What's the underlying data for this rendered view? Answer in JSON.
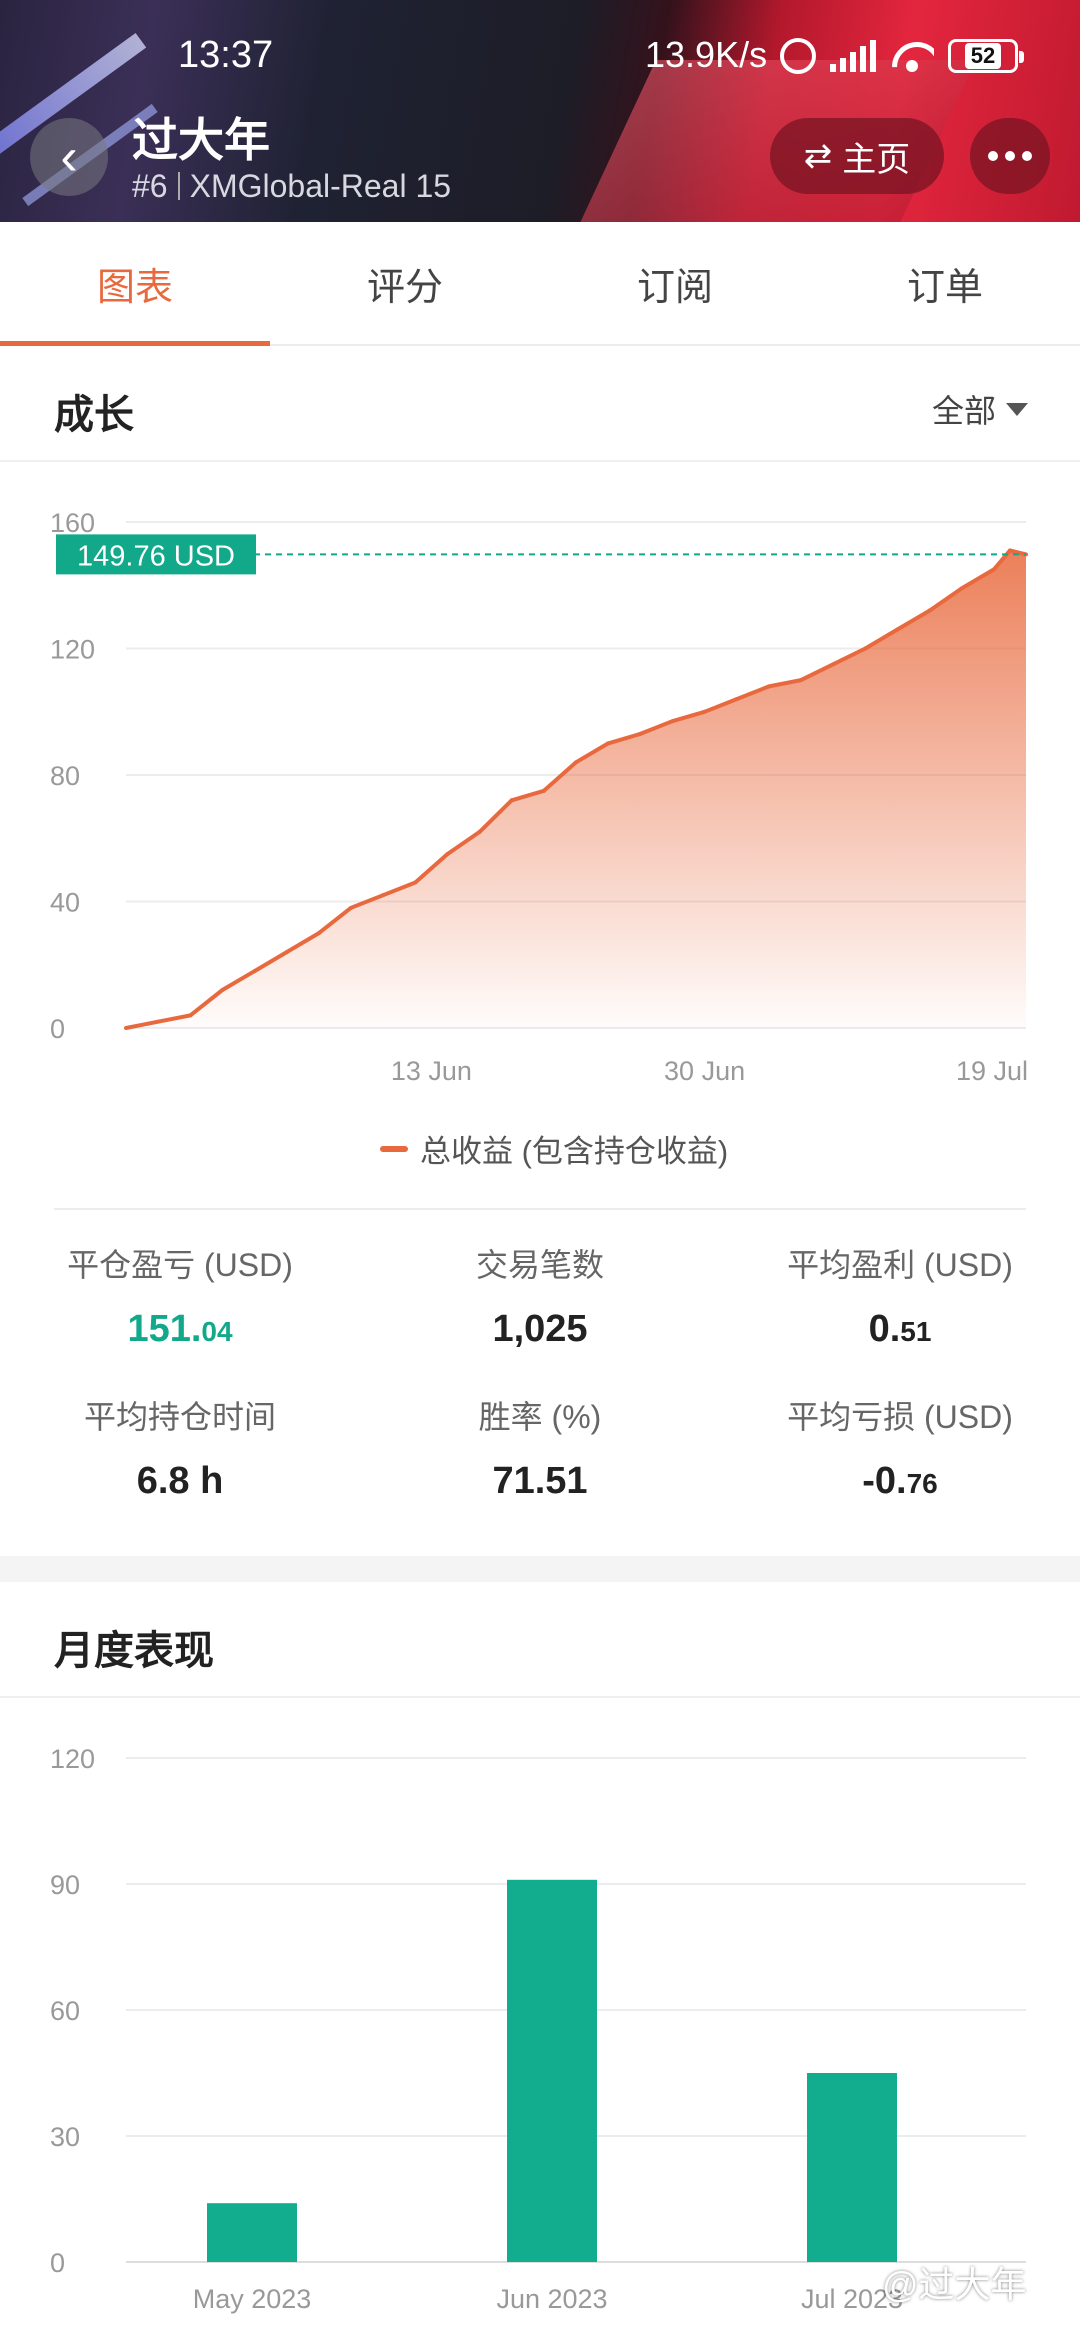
{
  "status_bar": {
    "time": "13:37",
    "net_speed": "13.9K/s",
    "battery": "52",
    "icons": [
      "alarm-icon",
      "signal-icon",
      "wifi-icon",
      "battery-icon"
    ]
  },
  "header": {
    "title": "过大年",
    "rank": "#6",
    "account": "XMGlobal-Real 15",
    "home_label": "主页",
    "icons": [
      "back-arrow-icon",
      "swap-icon",
      "more-icon"
    ]
  },
  "tabs": [
    {
      "label": "图表",
      "active": true
    },
    {
      "label": "评分",
      "active": false
    },
    {
      "label": "订阅",
      "active": false
    },
    {
      "label": "订单",
      "active": false
    }
  ],
  "growth": {
    "title": "成长",
    "filter_label": "全部",
    "current_value_label": "149.76 USD",
    "legend": "总收益 (包含持仓收益)"
  },
  "stats": [
    {
      "label": "平仓盈亏 (USD)",
      "main": "151.",
      "small": "04",
      "color": "green"
    },
    {
      "label": "交易笔数",
      "main": "1,025",
      "small": "",
      "color": "default"
    },
    {
      "label": "平均盈利 (USD)",
      "main": "0.",
      "small": "51",
      "color": "default"
    },
    {
      "label": "平均持仓时间",
      "main": "6.8 h",
      "small": "",
      "color": "default"
    },
    {
      "label": "胜率 (%)",
      "main": "71.51",
      "small": "",
      "color": "default"
    },
    {
      "label": "平均亏损 (USD)",
      "main": "-0.",
      "small": "76",
      "color": "default"
    }
  ],
  "monthly": {
    "title": "月度表现"
  },
  "watermark": "@过大年",
  "colors": {
    "accent": "#e8693d",
    "green": "#12a88a",
    "bar": "#12ad8e"
  },
  "chart_data": [
    {
      "type": "area",
      "title": "",
      "ylim": [
        0,
        160
      ],
      "yticks": [
        0,
        40,
        80,
        120,
        160
      ],
      "xticks": [
        "13 Jun",
        "30 Jun",
        "19 Jul"
      ],
      "reference_line": 149.76,
      "series": [
        {
          "name": "总收益 (包含持仓收益)",
          "x": [
            "2023-05-25",
            "2023-05-27",
            "2023-05-29",
            "2023-05-31",
            "2023-06-02",
            "2023-06-04",
            "2023-06-06",
            "2023-06-08",
            "2023-06-10",
            "2023-06-12",
            "2023-06-14",
            "2023-06-16",
            "2023-06-18",
            "2023-06-20",
            "2023-06-22",
            "2023-06-24",
            "2023-06-26",
            "2023-06-28",
            "2023-06-30",
            "2023-07-02",
            "2023-07-04",
            "2023-07-06",
            "2023-07-08",
            "2023-07-10",
            "2023-07-12",
            "2023-07-14",
            "2023-07-16",
            "2023-07-18",
            "2023-07-19",
            "2023-07-20"
          ],
          "values": [
            0,
            2,
            4,
            12,
            18,
            24,
            30,
            38,
            42,
            46,
            55,
            62,
            72,
            75,
            84,
            90,
            93,
            97,
            100,
            104,
            108,
            110,
            115,
            120,
            126,
            132,
            139,
            145,
            151,
            149.76
          ]
        }
      ]
    },
    {
      "type": "bar",
      "title": "",
      "categories": [
        "May 2023",
        "Jun 2023",
        "Jul 2023"
      ],
      "values": [
        14,
        91,
        45
      ],
      "ylim": [
        0,
        120
      ],
      "yticks": [
        0,
        30,
        60,
        90,
        120
      ]
    }
  ]
}
